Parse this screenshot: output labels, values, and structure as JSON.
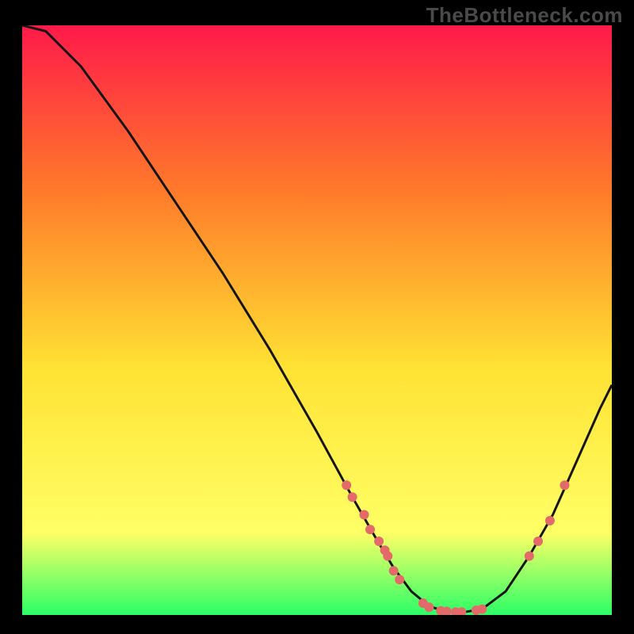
{
  "watermark": "TheBottleneck.com",
  "colors": {
    "gradient_top": "#ff1a4a",
    "gradient_mid_upper": "#ff7a2a",
    "gradient_mid": "#ffe233",
    "gradient_lower": "#ffff66",
    "gradient_bottom": "#2bff66",
    "curve_stroke": "#161616",
    "dot_fill": "#e46a6a",
    "frame_bg": "#000000"
  },
  "chart_data": {
    "type": "line",
    "title": "",
    "xlabel": "",
    "ylabel": "",
    "xlim": [
      0,
      100
    ],
    "ylim": [
      0,
      100
    ],
    "curve": [
      {
        "x": 0,
        "y": 100
      },
      {
        "x": 4,
        "y": 99
      },
      {
        "x": 10,
        "y": 93
      },
      {
        "x": 18,
        "y": 82
      },
      {
        "x": 26,
        "y": 70
      },
      {
        "x": 34,
        "y": 58
      },
      {
        "x": 42,
        "y": 45
      },
      {
        "x": 50,
        "y": 31
      },
      {
        "x": 56,
        "y": 20
      },
      {
        "x": 60,
        "y": 13
      },
      {
        "x": 63,
        "y": 8
      },
      {
        "x": 66,
        "y": 4
      },
      {
        "x": 69,
        "y": 1.5
      },
      {
        "x": 72,
        "y": 0.5
      },
      {
        "x": 75,
        "y": 0.5
      },
      {
        "x": 78,
        "y": 1
      },
      {
        "x": 82,
        "y": 4
      },
      {
        "x": 86,
        "y": 10
      },
      {
        "x": 90,
        "y": 17
      },
      {
        "x": 94,
        "y": 26
      },
      {
        "x": 98,
        "y": 35
      },
      {
        "x": 100,
        "y": 39
      }
    ],
    "dots": [
      {
        "x": 55,
        "y": 22
      },
      {
        "x": 56,
        "y": 20
      },
      {
        "x": 58,
        "y": 17
      },
      {
        "x": 59,
        "y": 14.5
      },
      {
        "x": 60.5,
        "y": 12.5
      },
      {
        "x": 61.5,
        "y": 11
      },
      {
        "x": 62,
        "y": 10
      },
      {
        "x": 63,
        "y": 7.5
      },
      {
        "x": 64,
        "y": 6
      },
      {
        "x": 68,
        "y": 2
      },
      {
        "x": 69,
        "y": 1.3
      },
      {
        "x": 71,
        "y": 0.7
      },
      {
        "x": 72,
        "y": 0.6
      },
      {
        "x": 73.5,
        "y": 0.5
      },
      {
        "x": 74.5,
        "y": 0.5
      },
      {
        "x": 77,
        "y": 0.8
      },
      {
        "x": 78,
        "y": 1
      },
      {
        "x": 86,
        "y": 10
      },
      {
        "x": 87.5,
        "y": 12.5
      },
      {
        "x": 89.5,
        "y": 16
      },
      {
        "x": 92,
        "y": 22
      }
    ]
  }
}
